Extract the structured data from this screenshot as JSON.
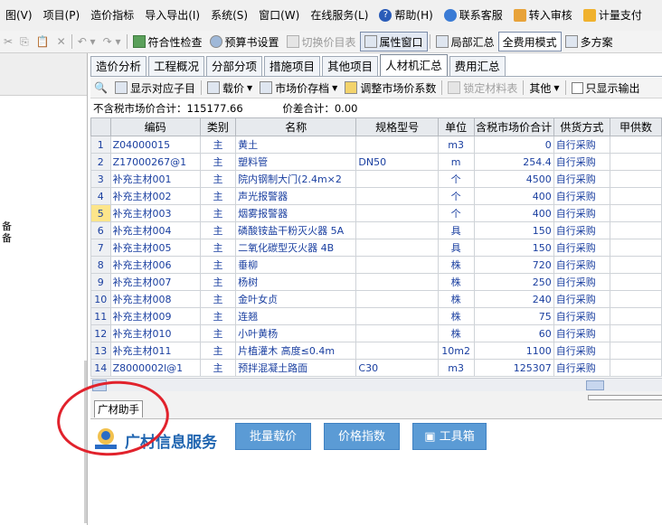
{
  "menubar": {
    "items": [
      "图(V)",
      "项目(P)",
      "造价指标",
      "导入导出(I)",
      "系统(S)",
      "窗口(W)",
      "在线服务(L)",
      "帮助(H)",
      "联系客服",
      "转入审核",
      "计量支付"
    ]
  },
  "toolbar": {
    "compliance_check": "符合性检查",
    "budget_settings": "预算书设置",
    "switch_price_table": "切换价目表",
    "property_window": "属性窗口",
    "partial_summary": "局部汇总",
    "full_fee_mode": "全费用模式",
    "multi_scheme": "多方案"
  },
  "tabs": [
    "造价分析",
    "工程概况",
    "分部分项",
    "措施项目",
    "其他项目",
    "人材机汇总",
    "费用汇总"
  ],
  "active_tab_index": 5,
  "subbar": {
    "show_sub_items": "显示对应子目",
    "load_price": "载价",
    "market_price_archive": "市场价存档",
    "adjust_market_coef": "调整市场价系数",
    "lock_material_table": "锁定材料表",
    "other": "其他",
    "only_show_output": "只显示输出"
  },
  "totals": {
    "excl_tax_label": "不含税市场价合计：",
    "excl_tax_value": "115177.66",
    "diff_label": "价差合计：",
    "diff_value": "0.00"
  },
  "table": {
    "headers": [
      "",
      "编码",
      "类别",
      "名称",
      "规格型号",
      "单位",
      "含税市场价合计",
      "供货方式",
      "甲供数"
    ],
    "rows": [
      [
        "1",
        "Z04000015",
        "主",
        "黄土",
        "",
        "m3",
        "0",
        "自行采购"
      ],
      [
        "2",
        "Z17000267@1",
        "主",
        "塑料管",
        "DN50",
        "m",
        "254.4",
        "自行采购"
      ],
      [
        "3",
        "补充主材001",
        "主",
        "院内钢制大门(2.4m×2",
        "",
        "个",
        "4500",
        "自行采购"
      ],
      [
        "4",
        "补充主材002",
        "主",
        "声光报警器",
        "",
        "个",
        "400",
        "自行采购"
      ],
      [
        "5",
        "补充主材003",
        "主",
        "烟雾报警器",
        "",
        "个",
        "400",
        "自行采购"
      ],
      [
        "6",
        "补充主材004",
        "主",
        "磷酸铵盐干粉灭火器 5A",
        "",
        "具",
        "150",
        "自行采购"
      ],
      [
        "7",
        "补充主材005",
        "主",
        "二氧化碳型灭火器 4B",
        "",
        "具",
        "150",
        "自行采购"
      ],
      [
        "8",
        "补充主材006",
        "主",
        "垂柳",
        "",
        "株",
        "720",
        "自行采购"
      ],
      [
        "9",
        "补充主材007",
        "主",
        "杨树",
        "",
        "株",
        "250",
        "自行采购"
      ],
      [
        "10",
        "补充主材008",
        "主",
        "金叶女贞",
        "",
        "株",
        "240",
        "自行采购"
      ],
      [
        "11",
        "补充主材009",
        "主",
        "连翘",
        "",
        "株",
        "75",
        "自行采购"
      ],
      [
        "12",
        "补充主材010",
        "主",
        "小叶黄杨",
        "",
        "株",
        "60",
        "自行采购"
      ],
      [
        "13",
        "补充主材011",
        "主",
        "片植灌木 高度≤0.4m",
        "",
        "10m2",
        "1100",
        "自行采购"
      ],
      [
        "14",
        "Z8000002l@1",
        "主",
        "预拌混凝土路面",
        "C30",
        "m3",
        "125307",
        "自行采购"
      ]
    ],
    "highlighted_row": "5"
  },
  "left_panel": {
    "text_line1": "备",
    "text_line2": "备"
  },
  "bottom_tab": "广材助手",
  "service": {
    "title": "广材信息服务",
    "batch_load": "批量载价",
    "price_index": "价格指数",
    "toolbox": "工具箱"
  }
}
